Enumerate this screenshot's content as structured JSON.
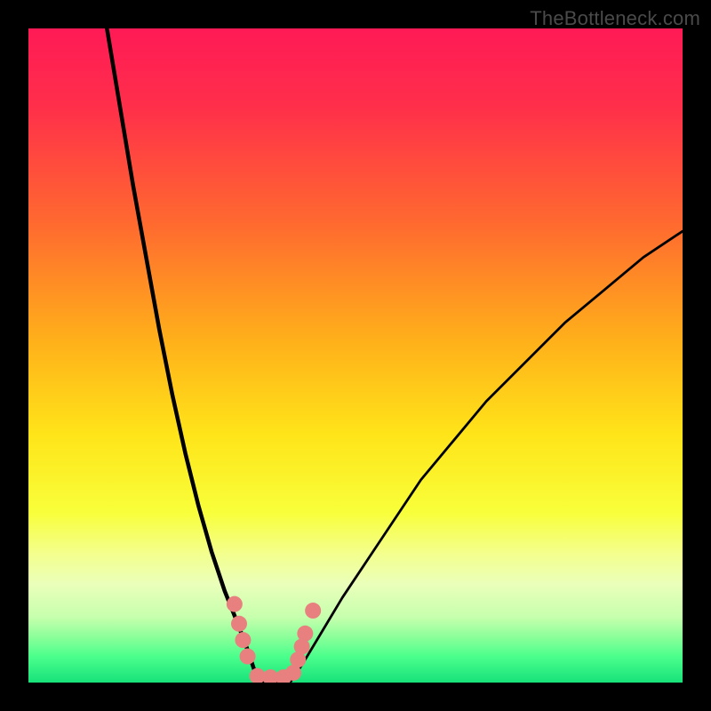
{
  "watermark": "TheBottleneck.com",
  "chart_data": {
    "type": "line",
    "title": "",
    "xlabel": "",
    "ylabel": "",
    "xlim": [
      0,
      100
    ],
    "ylim": [
      0,
      100
    ],
    "gradient_stops": [
      {
        "offset": 0,
        "color": "#ff1a56"
      },
      {
        "offset": 12,
        "color": "#ff2f4a"
      },
      {
        "offset": 30,
        "color": "#ff6a2f"
      },
      {
        "offset": 48,
        "color": "#ffb11a"
      },
      {
        "offset": 62,
        "color": "#ffe419"
      },
      {
        "offset": 74,
        "color": "#f8ff3a"
      },
      {
        "offset": 80,
        "color": "#f4ff8a"
      },
      {
        "offset": 85,
        "color": "#eaffba"
      },
      {
        "offset": 90,
        "color": "#c6ffad"
      },
      {
        "offset": 93,
        "color": "#8cff9a"
      },
      {
        "offset": 96,
        "color": "#4bff8c"
      },
      {
        "offset": 100,
        "color": "#17e27a"
      }
    ],
    "series": [
      {
        "name": "left-branch",
        "type": "line",
        "x": [
          12,
          14,
          16,
          18,
          20,
          22,
          24,
          26,
          28,
          30,
          32,
          33.5,
          34.5,
          35.2
        ],
        "y": [
          100,
          88,
          76,
          65,
          54,
          44,
          35,
          27,
          20,
          14,
          9,
          5,
          2,
          0
        ]
      },
      {
        "name": "right-branch",
        "type": "line",
        "x": [
          40,
          42,
          45,
          48,
          52,
          56,
          60,
          65,
          70,
          76,
          82,
          88,
          94,
          100
        ],
        "y": [
          0,
          3,
          8,
          13,
          19,
          25,
          31,
          37,
          43,
          49,
          55,
          60,
          65,
          69
        ]
      },
      {
        "name": "bottom-valley",
        "type": "line",
        "x": [
          35.2,
          36,
          37,
          38,
          39,
          40
        ],
        "y": [
          0,
          0,
          0,
          0,
          0,
          0
        ]
      }
    ],
    "markers": {
      "name": "highlight-points",
      "color": "#e98080",
      "radius": 9,
      "points": [
        {
          "x": 31.5,
          "y": 12
        },
        {
          "x": 32.2,
          "y": 9
        },
        {
          "x": 32.8,
          "y": 6.5
        },
        {
          "x": 33.5,
          "y": 4
        },
        {
          "x": 35,
          "y": 1
        },
        {
          "x": 37,
          "y": 0.8
        },
        {
          "x": 39,
          "y": 0.8
        },
        {
          "x": 40.5,
          "y": 1.5
        },
        {
          "x": 41.2,
          "y": 3.5
        },
        {
          "x": 41.8,
          "y": 5.5
        },
        {
          "x": 42.3,
          "y": 7.5
        },
        {
          "x": 43.5,
          "y": 11
        }
      ]
    }
  }
}
